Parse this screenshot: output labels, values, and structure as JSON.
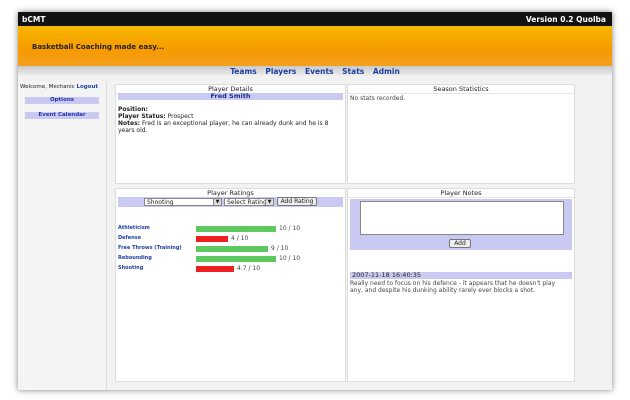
{
  "window": {
    "app_title": "bCMT",
    "version": "Version 0.2 Quolba"
  },
  "banner": {
    "tagline": "Basketball Coaching made easy..."
  },
  "nav": {
    "items": [
      "Teams",
      "Players",
      "Events",
      "Stats",
      "Admin"
    ]
  },
  "sidebar": {
    "welcome": "Welcome, Mechanic",
    "logout": "Logout",
    "buttons": [
      "Options",
      "Event Calendar"
    ]
  },
  "player_details": {
    "panel_title": "Player Details",
    "name": "Fred Smith",
    "position_label": "Position:",
    "status_label": "Player Status:",
    "status_value": "Prospect",
    "notes_label": "Notes:",
    "notes_value": "Fred is an exceptional player, he can already dunk and he is 8 years old."
  },
  "season_statistics": {
    "panel_title": "Season Statistics",
    "empty_text": "No stats recorded."
  },
  "player_ratings": {
    "panel_title": "Player Ratings",
    "category_select": "Shooting",
    "rating_select": "Select Rating",
    "add_button": "Add Rating",
    "ratings": [
      {
        "label": "Athleticism",
        "value": 10,
        "value_text": "10 / 10",
        "color": "#5fc85f"
      },
      {
        "label": "Defense",
        "value": 4,
        "value_text": "4 / 10",
        "color": "#ee1f1f"
      },
      {
        "label": "Free Throws (Training)",
        "value": 9,
        "value_text": "9 / 10",
        "color": "#5fc85f"
      },
      {
        "label": "Rebounding",
        "value": 10,
        "value_text": "10 / 10",
        "color": "#5fc85f"
      },
      {
        "label": "Shooting",
        "value": 4.7,
        "value_text": "4.7 / 10",
        "color": "#ee1f1f"
      }
    ],
    "max": 10
  },
  "player_notes": {
    "panel_title": "Player Notes",
    "add_button": "Add",
    "entries": [
      {
        "timestamp": "2007-11-18 16:40:35",
        "text": "Really need to focus on his defence - it appears that he doesn't play any, and despite his dunking ability rarely ever blocks a shot."
      }
    ]
  }
}
